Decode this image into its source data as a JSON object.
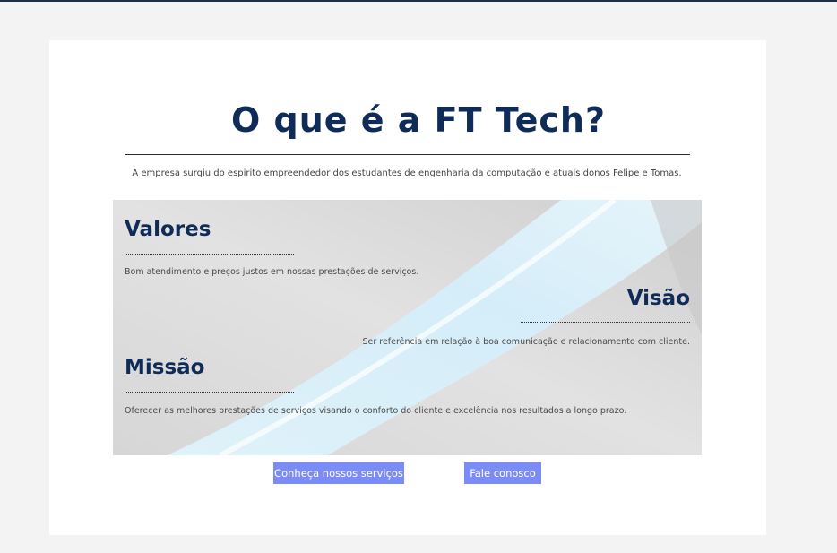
{
  "page": {
    "title": "O que é a FT Tech?",
    "intro": "A empresa surgiu do espirito empreendedor dos estudantes de engenharia da computação e atuais donos Felipe e Tomas."
  },
  "sections": {
    "valores": {
      "heading": "Valores",
      "text": "Bom atendimento e preços justos em nossas prestações de serviços."
    },
    "visao": {
      "heading": "Visão",
      "text": "Ser referência em relação à boa comunicação e relacionamento com cliente."
    },
    "missao": {
      "heading": "Missão",
      "text": "Oferecer as melhores prestações de serviços visando o conforto do cliente e excelência nos resultados a longo prazo."
    }
  },
  "buttons": {
    "services": "Conheça nossos serviços",
    "contact": "Fale conosco"
  },
  "colors": {
    "heading": "#0f2b57",
    "button": "#7b8cf7",
    "background": "#f3f3f3"
  }
}
